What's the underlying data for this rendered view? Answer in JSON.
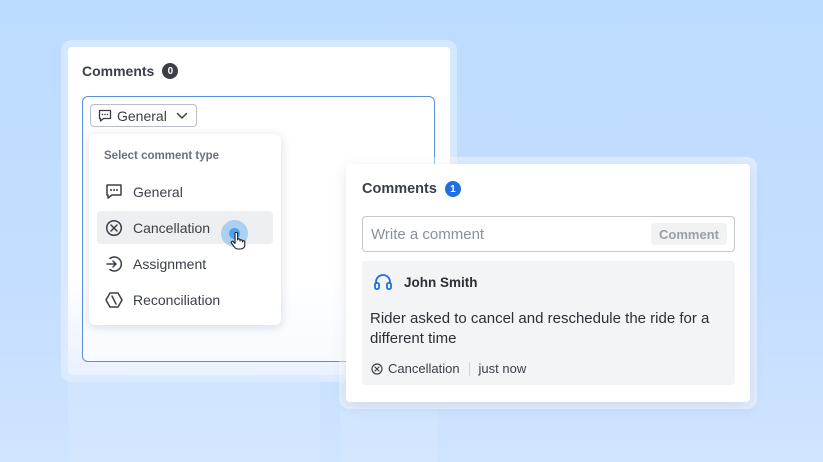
{
  "colors": {
    "accent": "#1f6fe0",
    "badge_zero": "#3b3f45",
    "border_focus": "#5b8fe0",
    "highlight": "#4fa3ea"
  },
  "left_card": {
    "title": "Comments",
    "count": "0",
    "type_select": {
      "label": "General",
      "icon": "chat-icon",
      "caret": "chevron-down-icon"
    },
    "dropdown": {
      "heading": "Select comment type",
      "items": [
        {
          "label": "General",
          "icon": "chat-icon"
        },
        {
          "label": "Cancellation",
          "icon": "x-circle-icon",
          "active": true
        },
        {
          "label": "Assignment",
          "icon": "assign-icon"
        },
        {
          "label": "Reconciliation",
          "icon": "reconcile-icon"
        }
      ]
    }
  },
  "right_card": {
    "title": "Comments",
    "count": "1",
    "input": {
      "placeholder": "Write a comment",
      "value": ""
    },
    "submit_label": "Comment",
    "comment": {
      "author": "John Smith",
      "author_icon": "headset-icon",
      "body": "Rider asked to cancel and reschedule the ride for a different time",
      "type_label": "Cancellation",
      "type_icon": "x-circle-icon",
      "time": "just now"
    }
  }
}
